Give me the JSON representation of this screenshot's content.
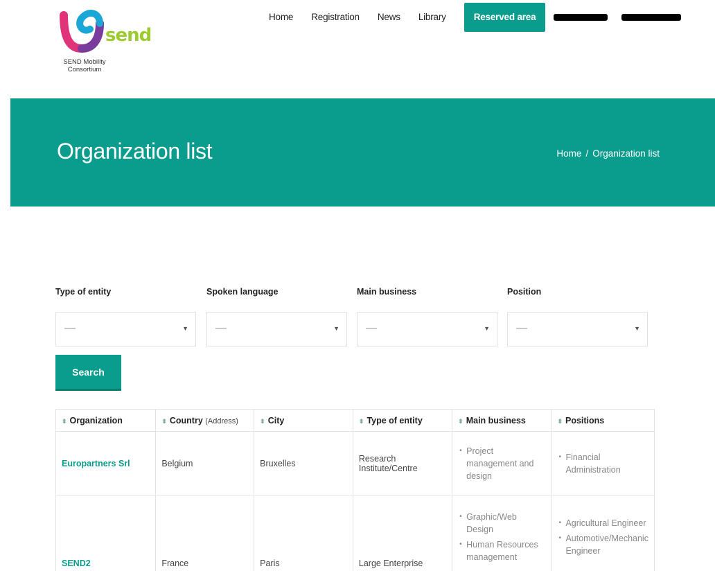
{
  "logo": {
    "word": "send",
    "caption": "SEND Mobility Consortium"
  },
  "nav": {
    "items": [
      "Home",
      "Registration",
      "News",
      "Library"
    ],
    "active": "Reserved area"
  },
  "banner": {
    "title": "Organization list",
    "breadcrumb": {
      "home": "Home",
      "sep": "/",
      "current": "Organization list"
    }
  },
  "filters": [
    {
      "label": "Type of entity",
      "value": "—"
    },
    {
      "label": "Spoken language",
      "value": "—"
    },
    {
      "label": "Main business",
      "value": "—"
    },
    {
      "label": "Position",
      "value": "—"
    }
  ],
  "search": {
    "label": "Search"
  },
  "table": {
    "headers": {
      "organization": "Organization",
      "country": "Country",
      "country_sub": "(Address)",
      "city": "City",
      "type": "Type of entity",
      "business": "Main business",
      "positions": "Positions"
    },
    "rows": [
      {
        "organization": "Europartners Srl",
        "country": "Belgium",
        "city": "Bruxelles",
        "type": "Research Institute/Centre",
        "business": [
          "Project management and design"
        ],
        "positions": [
          "Financial Administration"
        ]
      },
      {
        "organization": "SEND2",
        "country": "France",
        "city": "Paris",
        "type": "Large Enterprise",
        "business": [
          "Graphic/Web Design",
          "Human Resources management"
        ],
        "positions": [
          "Agricultural Engineer",
          "Automotive/Mechanic Engineer"
        ]
      }
    ]
  },
  "colors": {
    "accent": "#0a9c8c",
    "logo_green": "#9ccb2e"
  }
}
